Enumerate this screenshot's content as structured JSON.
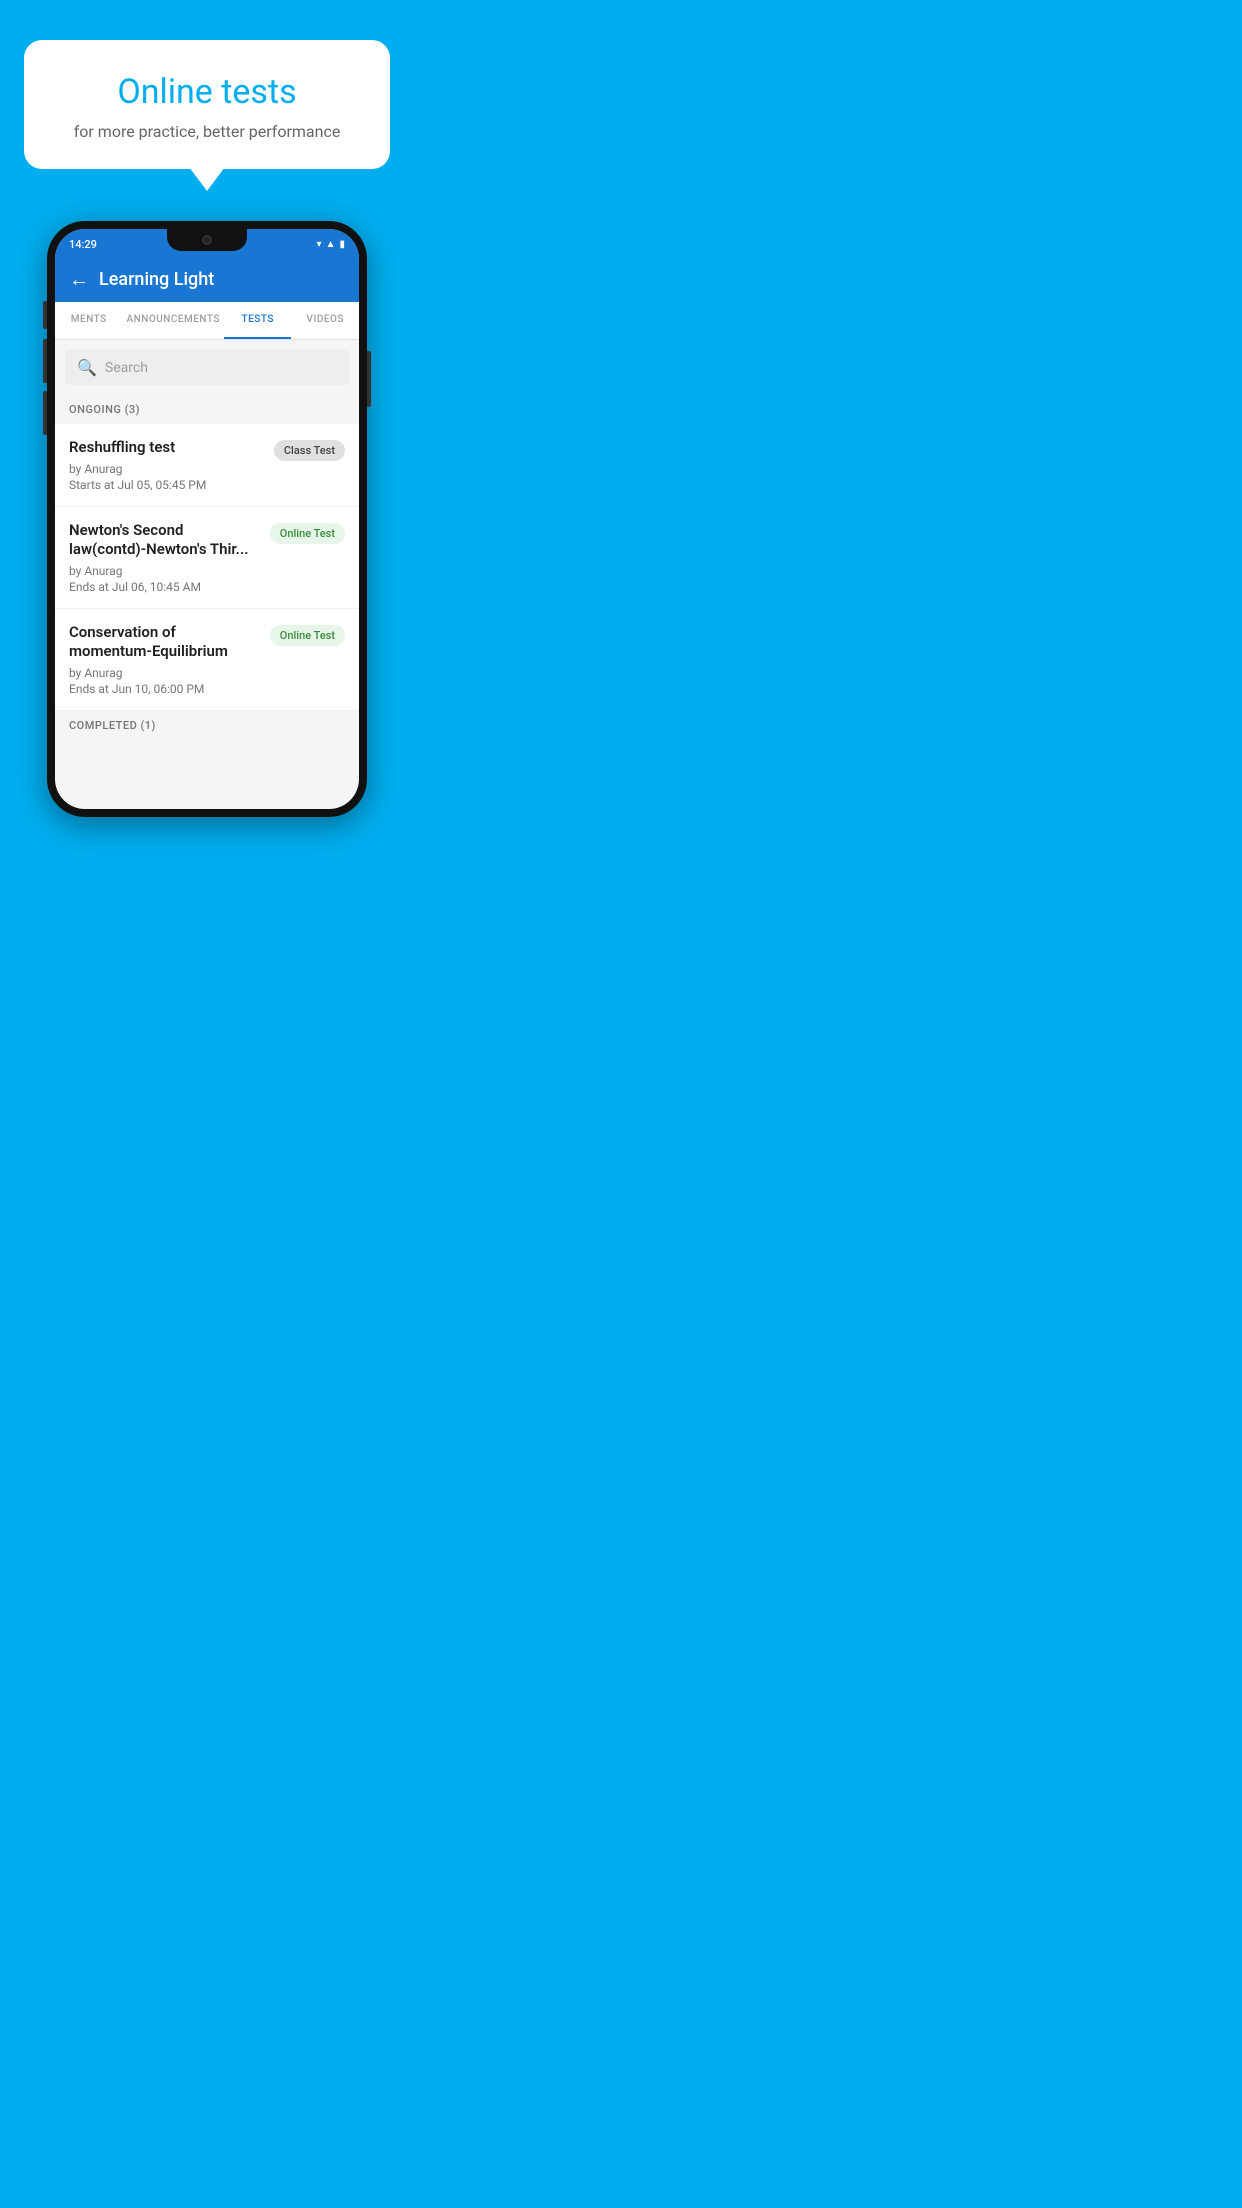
{
  "promo": {
    "title": "Online tests",
    "subtitle": "for more practice, better performance"
  },
  "phone": {
    "status_time": "14:29",
    "app_title": "Learning Light",
    "tabs": [
      {
        "label": "MENTS",
        "active": false
      },
      {
        "label": "ANNOUNCEMENTS",
        "active": false
      },
      {
        "label": "TESTS",
        "active": true
      },
      {
        "label": "VIDEOS",
        "active": false
      }
    ],
    "search_placeholder": "Search",
    "sections": [
      {
        "header": "ONGOING (3)",
        "items": [
          {
            "name": "Reshuffling test",
            "by": "by Anurag",
            "time_label": "Starts at",
            "time": "Jul 05, 05:45 PM",
            "badge": "Class Test",
            "badge_type": "class"
          },
          {
            "name": "Newton's Second law(contd)-Newton's Thir...",
            "by": "by Anurag",
            "time_label": "Ends at",
            "time": "Jul 06, 10:45 AM",
            "badge": "Online Test",
            "badge_type": "online"
          },
          {
            "name": "Conservation of momentum-Equilibrium",
            "by": "by Anurag",
            "time_label": "Ends at",
            "time": "Jun 10, 06:00 PM",
            "badge": "Online Test",
            "badge_type": "online"
          }
        ]
      }
    ],
    "completed_label": "COMPLETED (1)"
  }
}
